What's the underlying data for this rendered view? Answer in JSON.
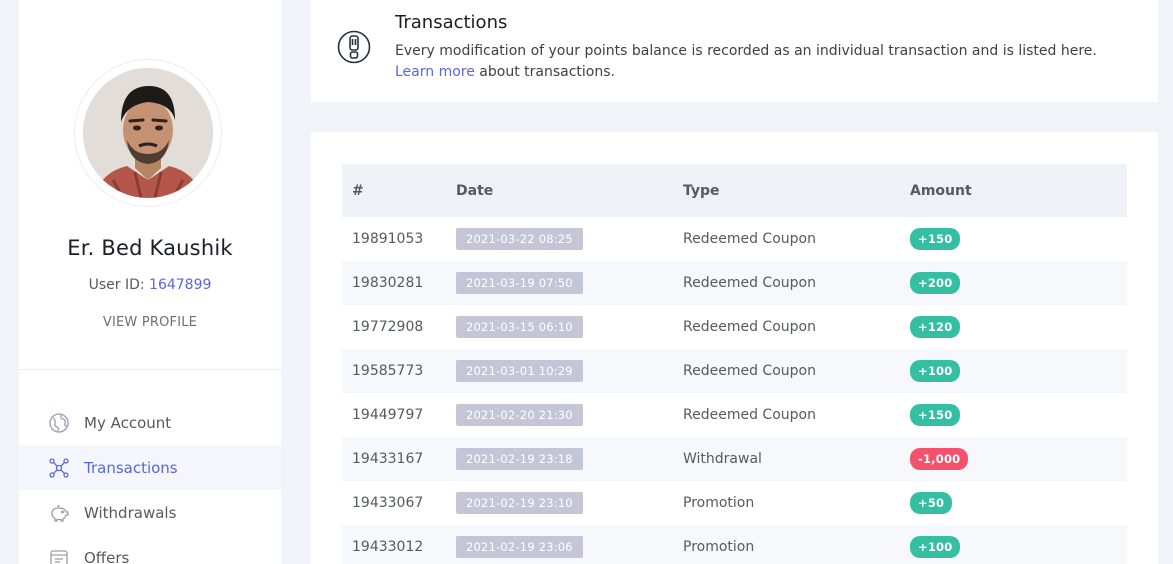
{
  "colors": {
    "accent": "#5867dd",
    "positive": "#34bfa3",
    "negative": "#f4516c",
    "date_badge": "#c4c5d6"
  },
  "profile": {
    "name": "Er. Bed Kaushik",
    "user_id_label": "User ID:",
    "user_id": "1647899",
    "view_profile_label": "VIEW PROFILE"
  },
  "nav": {
    "items": [
      {
        "label": "My Account",
        "icon": "globe-icon",
        "active": false
      },
      {
        "label": "Transactions",
        "icon": "network-icon",
        "active": true
      },
      {
        "label": "Withdrawals",
        "icon": "piggy-bank-icon",
        "active": false
      },
      {
        "label": "Offers",
        "icon": "tag-icon",
        "active": false
      }
    ]
  },
  "info": {
    "title": "Transactions",
    "text": "Every modification of your points balance is recorded as an individual transaction and is listed here.",
    "link_text": "Learn more",
    "link_suffix": " about transactions.",
    "icon": "exclamation-icon"
  },
  "table": {
    "headers": [
      "#",
      "Date",
      "Type",
      "Amount"
    ],
    "rows": [
      {
        "id": "19891053",
        "date": "2021-03-22 08:25",
        "type": "Redeemed Coupon",
        "amount": "+150",
        "positive": true
      },
      {
        "id": "19830281",
        "date": "2021-03-19 07:50",
        "type": "Redeemed Coupon",
        "amount": "+200",
        "positive": true
      },
      {
        "id": "19772908",
        "date": "2021-03-15 06:10",
        "type": "Redeemed Coupon",
        "amount": "+120",
        "positive": true
      },
      {
        "id": "19585773",
        "date": "2021-03-01 10:29",
        "type": "Redeemed Coupon",
        "amount": "+100",
        "positive": true
      },
      {
        "id": "19449797",
        "date": "2021-02-20 21:30",
        "type": "Redeemed Coupon",
        "amount": "+150",
        "positive": true
      },
      {
        "id": "19433167",
        "date": "2021-02-19 23:18",
        "type": "Withdrawal",
        "amount": "-1,000",
        "positive": false
      },
      {
        "id": "19433067",
        "date": "2021-02-19 23:10",
        "type": "Promotion",
        "amount": "+50",
        "positive": true
      },
      {
        "id": "19433012",
        "date": "2021-02-19 23:06",
        "type": "Promotion",
        "amount": "+100",
        "positive": true
      }
    ]
  }
}
